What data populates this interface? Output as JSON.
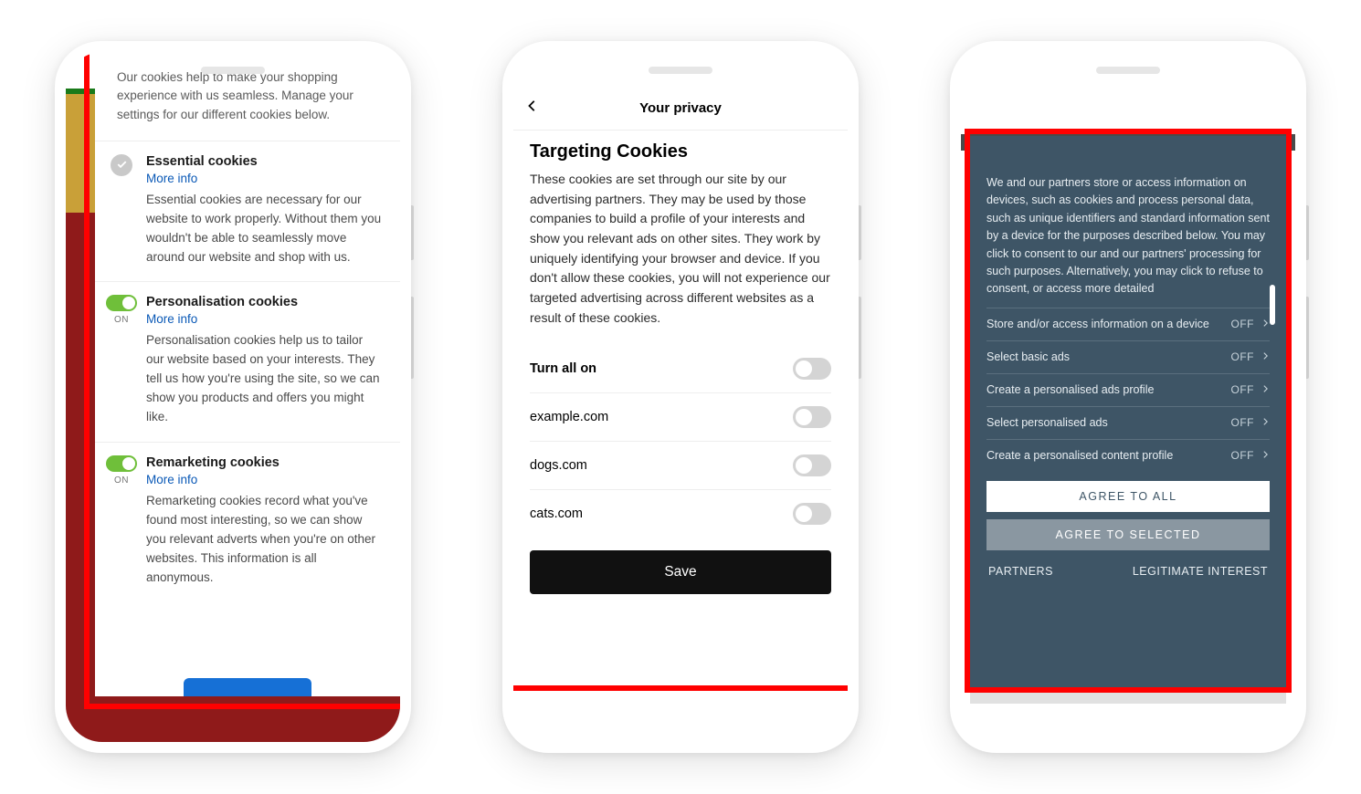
{
  "phone1": {
    "intro": "Our cookies help to make your shopping experience with us seamless. Manage your settings for our different cookies below.",
    "sections": [
      {
        "title": "Essential cookies",
        "link": "More info",
        "desc": "Essential cookies are necessary for our website to work properly. Without them you wouldn't be able to seamlessly move around our website and shop with us."
      },
      {
        "title": "Personalisation cookies",
        "status": "ON",
        "link": "More info",
        "desc": "Personalisation cookies help us to tailor our website based on your interests. They tell us how you're using the site, so we can show you products and offers you might like."
      },
      {
        "title": "Remarketing cookies",
        "status": "ON",
        "link": "More info",
        "desc": "Remarketing cookies record what you've found most interesting, so we can show you relevant adverts when you're on other websites. This information is all anonymous."
      }
    ]
  },
  "phone2": {
    "header": "Your privacy",
    "title": "Targeting Cookies",
    "desc": "These cookies are set through our site by our advertising partners. They may be used by those companies to build a profile of your interests and show you relevant ads on other sites. They work by uniquely identifying your browser and device. If you don't allow these cookies, you will not experience our targeted advertising across different websites as a result of these cookies.",
    "rows": [
      "Turn all on",
      "example.com",
      "dogs.com",
      "cats.com"
    ],
    "save": "Save"
  },
  "phone3": {
    "intro": "We and our partners store or access information on devices, such as cookies and process personal data, such as unique identifiers and standard information sent by a device for the purposes described below. You may click to consent to our and our partners' processing for such purposes. Alternatively, you may click to refuse to consent, or access more detailed",
    "off": "OFF",
    "items": [
      "Store and/or access information on a device",
      "Select basic ads",
      "Create a personalised ads profile",
      "Select personalised ads",
      "Create a personalised content profile"
    ],
    "agree_all": "AGREE TO ALL",
    "agree_sel": "AGREE TO SELECTED",
    "footer_left": "PARTNERS",
    "footer_right": "LEGITIMATE INTEREST"
  }
}
